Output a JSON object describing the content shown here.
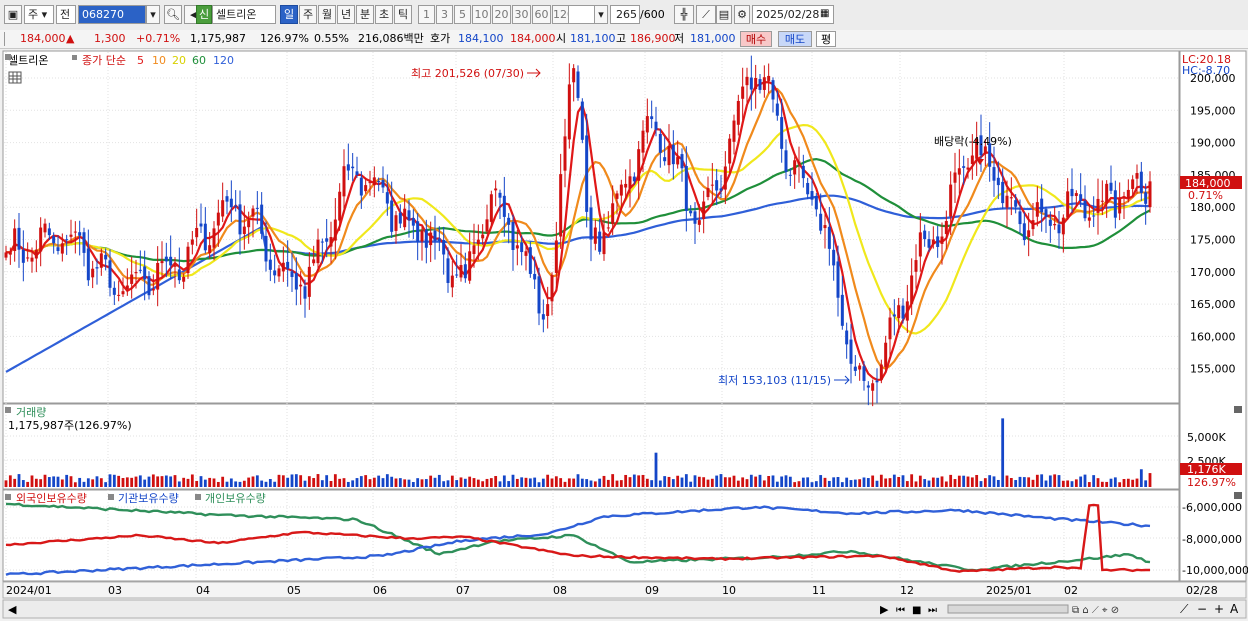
{
  "toolbar": {
    "type_select": "주",
    "mode_select": "전",
    "code": "068270",
    "credit_badge": "신",
    "stock_name": "셀트리온",
    "period_tabs": [
      "일",
      "주",
      "월",
      "년",
      "분",
      "초",
      "틱"
    ],
    "active_period": "일",
    "interval_buttons": [
      "1",
      "3",
      "5",
      "10",
      "20",
      "30",
      "60",
      "120"
    ],
    "count": "265",
    "count_total": "/600",
    "date": "2025/02/28"
  },
  "quote": {
    "price": "184,000",
    "change_arrow": "▲",
    "change": "1,300",
    "change_pct": "+0.71%",
    "volume": "1,175,987",
    "volume_ratio": "126.97%",
    "turnover": "0.55%",
    "amount": "216,086백만",
    "ask_label": "호가",
    "ask1": "184,100",
    "ask2": "184,000",
    "open_label": "시",
    "open": "181,100",
    "high_label": "고",
    "high": "186,900",
    "low_label": "저",
    "low": "181,000",
    "buy_btn": "매수",
    "sell_btn": "매도",
    "eval_btn": "평"
  },
  "price_panel": {
    "name_label": "셀트리온",
    "legend_prefix": "종가 단순",
    "ma_labels": [
      "5",
      "10",
      "20",
      "60",
      "120"
    ],
    "lc": "LC:20.18",
    "hc": "HC:-8.70",
    "high_annotation": "최고 201,526 (07/30)",
    "low_annotation": "최저 153,103 (11/15)",
    "dividend_annotation": "배당락(-4.49%)",
    "current_price_tag": "184,000",
    "current_pct_tag": "0.71%",
    "y_ticks": [
      "200,000",
      "195,000",
      "190,000",
      "185,000",
      "180,000",
      "175,000",
      "170,000",
      "165,000",
      "160,000",
      "155,000"
    ]
  },
  "volume_panel": {
    "title": "거래량",
    "info": "1,175,987주(126.97%)",
    "y_ticks": [
      "5,000K",
      "2,500K"
    ],
    "current_tag": "1,176K",
    "pct_tag": "126.97%"
  },
  "holding_panel": {
    "legend": [
      "외국인보유수량",
      "기관보유수량",
      "개인보유수량"
    ],
    "y_ticks": [
      "-6,000,000",
      "-8,000,000",
      "-10,000,000"
    ]
  },
  "x_axis": [
    "2024/01",
    "03",
    "04",
    "05",
    "06",
    "07",
    "08",
    "09",
    "10",
    "11",
    "12",
    "2025/01",
    "02",
    "02/28"
  ],
  "colors": {
    "up": "#d01010",
    "down": "#1446c8",
    "ma5": "#e01818",
    "ma10": "#f08a1c",
    "ma20": "#f0e81c",
    "ma60": "#1f8f3a",
    "ma120": "#2f5fd8",
    "foreign": "#3060d8",
    "institution": "#d81818",
    "individual": "#2f8f5a"
  },
  "chart_data": {
    "type": "candlestick",
    "x_range": [
      "2024/01",
      "2025/02/28"
    ],
    "y_range": [
      153000,
      202000
    ],
    "price_anchors": [
      [
        "2024/01/02",
        173000
      ],
      [
        "2024/01/25",
        175000
      ],
      [
        "2024/02/15",
        167000
      ],
      [
        "2024/03/05",
        171000
      ],
      [
        "2024/03/25",
        180000
      ],
      [
        "2024/04/20",
        168000
      ],
      [
        "2024/05/10",
        185000
      ],
      [
        "2024/05/30",
        178000
      ],
      [
        "2024/06/20",
        169000
      ],
      [
        "2024/06/30",
        182000
      ],
      [
        "2024/07/20",
        165000
      ],
      [
        "2024/07/30",
        201526
      ],
      [
        "2024/08/05",
        175000
      ],
      [
        "2024/08/30",
        192000
      ],
      [
        "2024/09/15",
        178000
      ],
      [
        "2024/10/05",
        200000
      ],
      [
        "2024/10/25",
        182000
      ],
      [
        "2024/11/15",
        153103
      ],
      [
        "2024/12/10",
        175000
      ],
      [
        "2024/12/25",
        188000
      ],
      [
        "2025/01/15",
        178000
      ],
      [
        "2025/02/10",
        181000
      ],
      [
        "2025/02/28",
        184000
      ]
    ],
    "volume_y_range": [
      0,
      6000000
    ],
    "volume_current": 1175987,
    "holding_y_range": [
      -10400000,
      -5700000
    ]
  }
}
